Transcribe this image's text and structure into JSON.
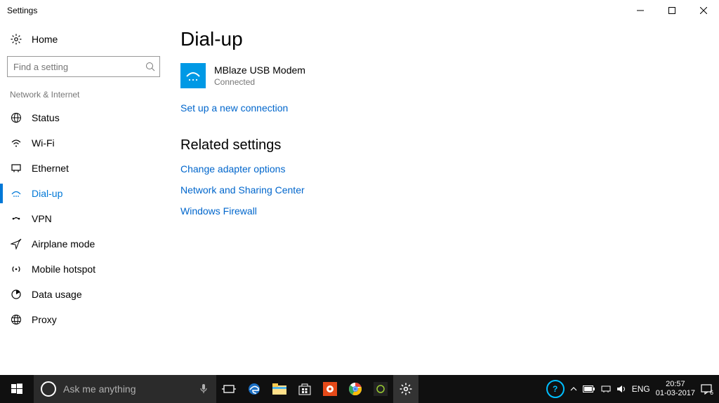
{
  "window": {
    "title": "Settings"
  },
  "sidebar": {
    "home": "Home",
    "search_placeholder": "Find a setting",
    "category": "Network & Internet",
    "items": [
      {
        "label": "Status"
      },
      {
        "label": "Wi-Fi"
      },
      {
        "label": "Ethernet"
      },
      {
        "label": "Dial-up"
      },
      {
        "label": "VPN"
      },
      {
        "label": "Airplane mode"
      },
      {
        "label": "Mobile hotspot"
      },
      {
        "label": "Data usage"
      },
      {
        "label": "Proxy"
      }
    ]
  },
  "main": {
    "title": "Dial-up",
    "connection": {
      "name": "MBlaze USB Modem",
      "status": "Connected"
    },
    "setup_link": "Set up a new connection",
    "related_title": "Related settings",
    "related_links": [
      "Change adapter options",
      "Network and Sharing Center",
      "Windows Firewall"
    ]
  },
  "taskbar": {
    "cortana": "Ask me anything",
    "lang": "ENG",
    "time": "20:57",
    "date": "01-03-2017",
    "notif_count": "6"
  }
}
